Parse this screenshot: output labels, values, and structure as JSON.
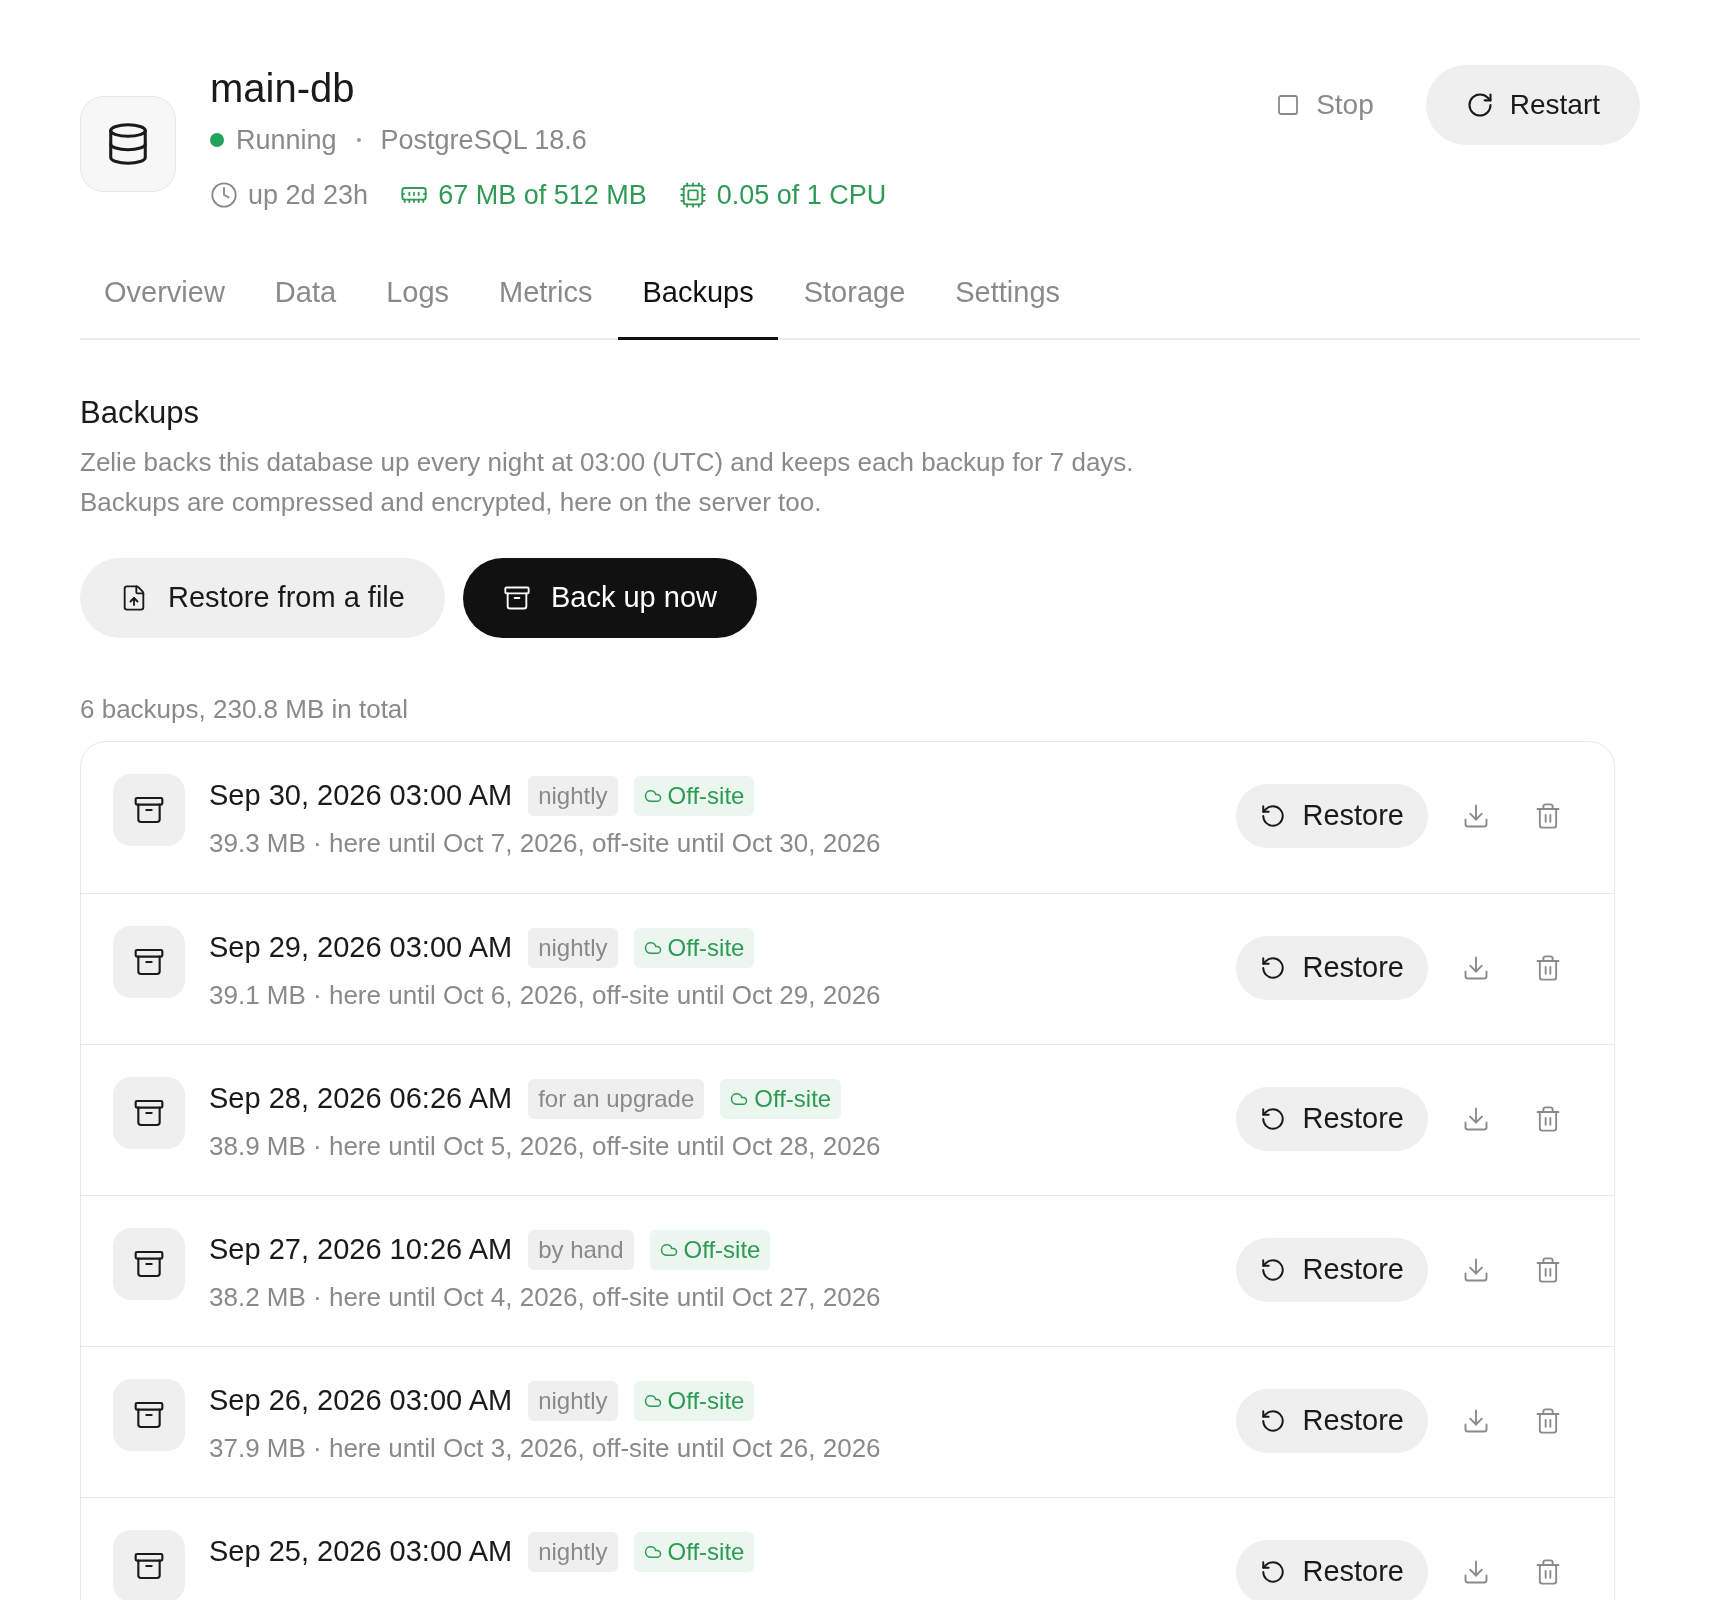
{
  "header": {
    "title": "main-db",
    "status": {
      "label": "Running",
      "color": "#22a55a"
    },
    "engine": "PostgreSQL 18.6",
    "uptime": "up 2d 23h",
    "memory": "67 MB of 512 MB",
    "cpu": "0.05 of 1 CPU",
    "actions": [
      {
        "label": "Stop",
        "kind": "stop"
      },
      {
        "label": "Restart",
        "kind": "restart"
      }
    ]
  },
  "tabs": [
    {
      "label": "Overview",
      "selected": false
    },
    {
      "label": "Data",
      "selected": false
    },
    {
      "label": "Logs",
      "selected": false
    },
    {
      "label": "Metrics",
      "selected": false
    },
    {
      "label": "Backups",
      "selected": true
    },
    {
      "label": "Storage",
      "selected": false
    },
    {
      "label": "Settings",
      "selected": false
    }
  ],
  "section": {
    "title": "Backups",
    "description": "Zelie backs this database up every night at 03:00 (UTC) and keeps each backup for 7 days. Backups are compressed and encrypted, here on the server too.",
    "buttons": [
      {
        "label": "Restore from a file",
        "kind": "secondary"
      },
      {
        "label": "Back up now",
        "kind": "primary"
      }
    ],
    "summary": "6 backups, 230.8 MB in total"
  },
  "backups": [
    {
      "date": "Sep 30, 2026 03:00 AM",
      "tags": [
        {
          "label": "nightly",
          "kind": "plain"
        },
        {
          "label": "Off-site",
          "kind": "offsite"
        }
      ],
      "meta": "39.3 MB · here until Oct 7, 2026, off-site until Oct 30, 2026",
      "action": "Restore"
    },
    {
      "date": "Sep 29, 2026 03:00 AM",
      "tags": [
        {
          "label": "nightly",
          "kind": "plain"
        },
        {
          "label": "Off-site",
          "kind": "offsite"
        }
      ],
      "meta": "39.1 MB · here until Oct 6, 2026, off-site until Oct 29, 2026",
      "action": "Restore"
    },
    {
      "date": "Sep 28, 2026 06:26 AM",
      "tags": [
        {
          "label": "for an upgrade",
          "kind": "plain"
        },
        {
          "label": "Off-site",
          "kind": "offsite"
        }
      ],
      "meta": "38.9 MB · here until Oct 5, 2026, off-site until Oct 28, 2026",
      "action": "Restore"
    },
    {
      "date": "Sep 27, 2026 10:26 AM",
      "tags": [
        {
          "label": "by hand",
          "kind": "plain"
        },
        {
          "label": "Off-site",
          "kind": "offsite"
        }
      ],
      "meta": "38.2 MB · here until Oct 4, 2026, off-site until Oct 27, 2026",
      "action": "Restore"
    },
    {
      "date": "Sep 26, 2026 03:00 AM",
      "tags": [
        {
          "label": "nightly",
          "kind": "plain"
        },
        {
          "label": "Off-site",
          "kind": "offsite"
        }
      ],
      "meta": "37.9 MB · here until Oct 3, 2026, off-site until Oct 26, 2026",
      "action": "Restore"
    },
    {
      "date": "Sep 25, 2026 03:00 AM",
      "tags": [
        {
          "label": "nightly",
          "kind": "plain"
        },
        {
          "label": "Off-site",
          "kind": "offsite"
        }
      ],
      "action": "Restore"
    }
  ]
}
